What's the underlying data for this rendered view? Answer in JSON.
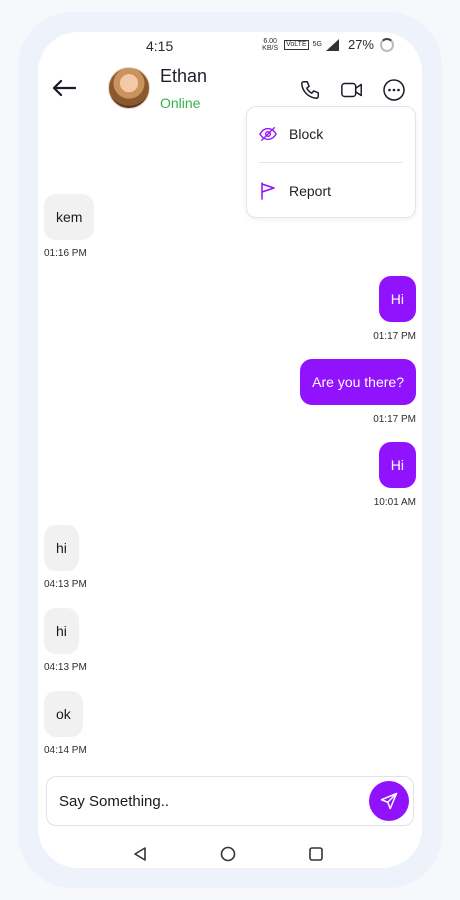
{
  "status_bar": {
    "time": "4:15",
    "speed_value": "6.00",
    "speed_unit": "KB/S",
    "volte": "VoLTE",
    "network": "5G",
    "battery": "27%"
  },
  "header": {
    "contact_name": "Ethan",
    "contact_status": "Online"
  },
  "menu": {
    "items": [
      {
        "label": "Block",
        "icon": "eye-off-icon"
      },
      {
        "label": "Report",
        "icon": "flag-icon"
      }
    ]
  },
  "messages": [
    {
      "direction": "incoming",
      "text": "kem",
      "time": "01:16 PM"
    },
    {
      "direction": "outgoing",
      "text": "Hi",
      "time": "01:17 PM"
    },
    {
      "direction": "outgoing",
      "text": "Are you there?",
      "time": "01:17 PM"
    },
    {
      "direction": "outgoing",
      "text": "Hi",
      "time": "10:01 AM"
    },
    {
      "direction": "incoming",
      "text": "hi",
      "time": "04:13 PM"
    },
    {
      "direction": "incoming",
      "text": "hi",
      "time": "04:13 PM"
    },
    {
      "direction": "incoming",
      "text": "ok",
      "time": "04:14 PM"
    }
  ],
  "composer": {
    "placeholder": "Say Something.."
  },
  "colors": {
    "accent": "#9112FC",
    "online": "#32B34A",
    "incoming_bubble": "#F1F1F2"
  }
}
